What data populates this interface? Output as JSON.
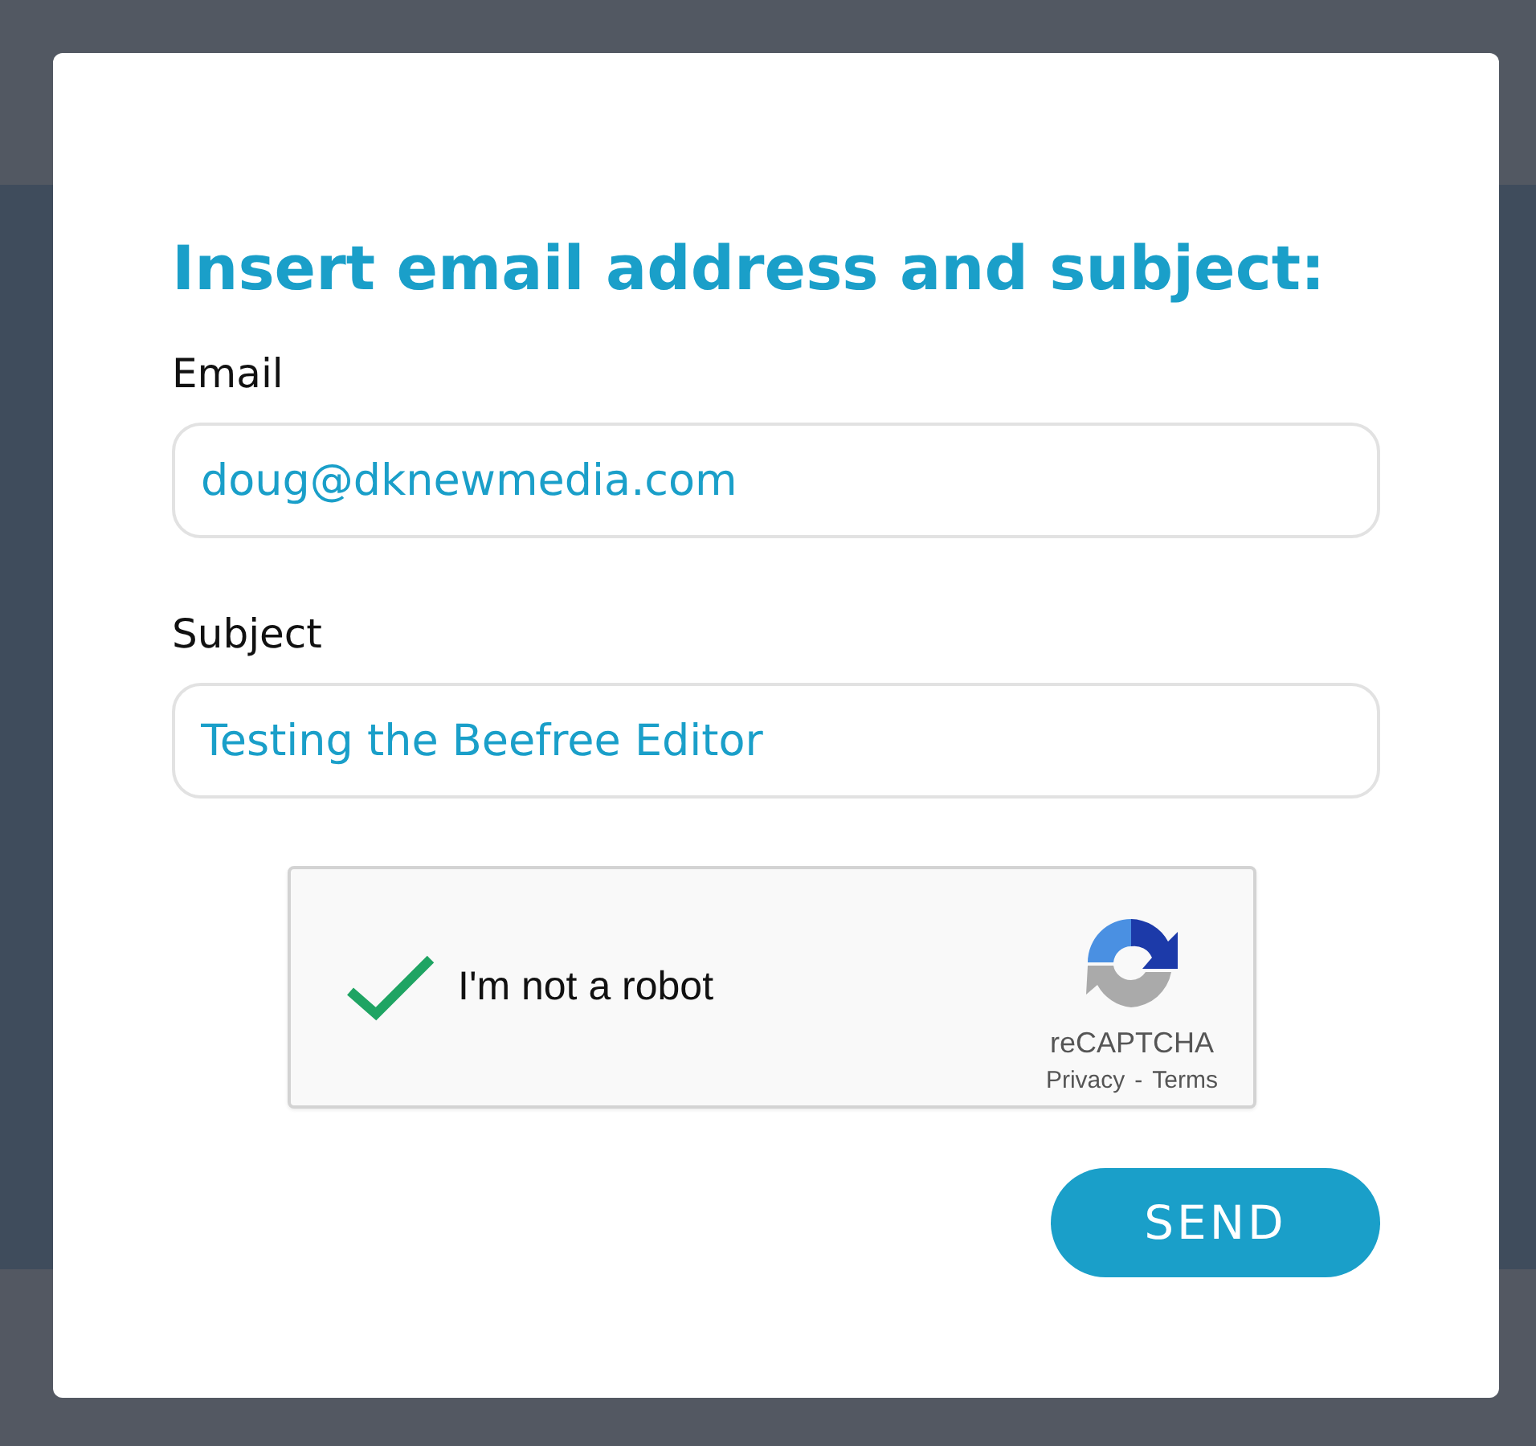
{
  "dialog": {
    "title": "Insert email address and subject:",
    "fields": [
      {
        "label": "Email",
        "value": "doug@dknewmedia.com"
      },
      {
        "label": "Subject",
        "value": "Testing the Beefree Editor"
      }
    ],
    "captcha": {
      "label": "I'm not a robot",
      "checked": true,
      "brand": "reCAPTCHA",
      "links": [
        "Privacy",
        "Terms"
      ],
      "separator": "-"
    },
    "button": "SEND"
  }
}
